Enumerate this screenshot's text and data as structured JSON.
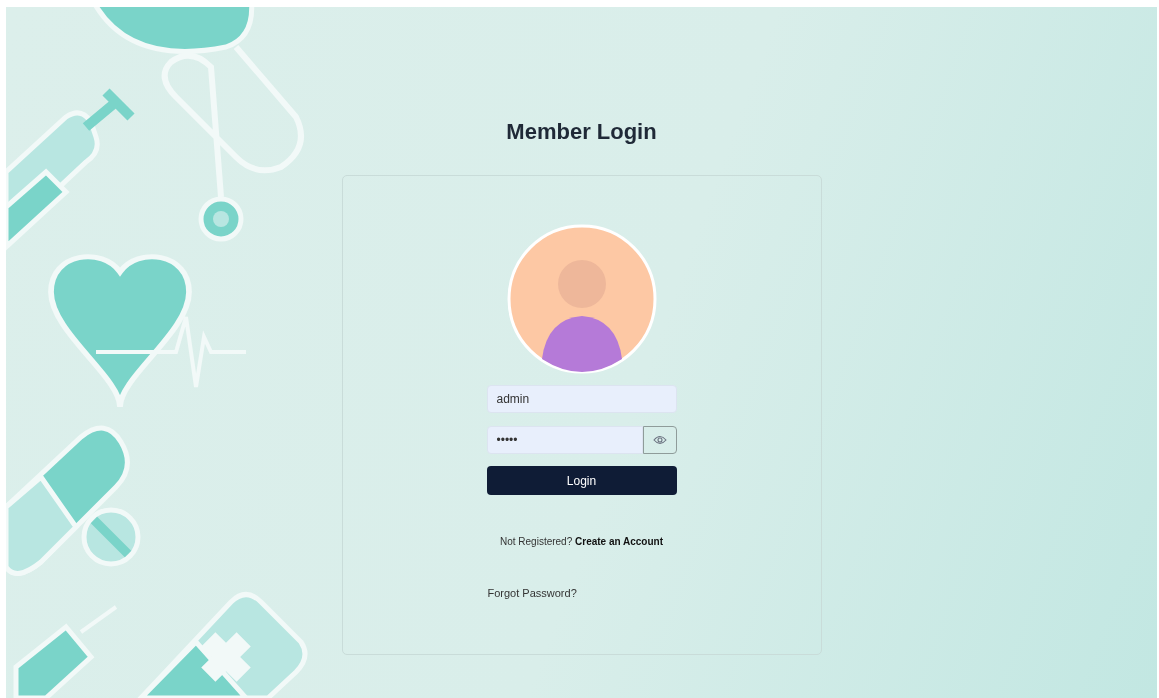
{
  "title": "Member Login",
  "login_form": {
    "username": {
      "value": "admin"
    },
    "password": {
      "value": "•••••"
    },
    "login_button": "Login",
    "register_prompt": {
      "text": "Not Registered?",
      "link": "Create an Account"
    },
    "forgot_password": "Forgot Password?"
  }
}
